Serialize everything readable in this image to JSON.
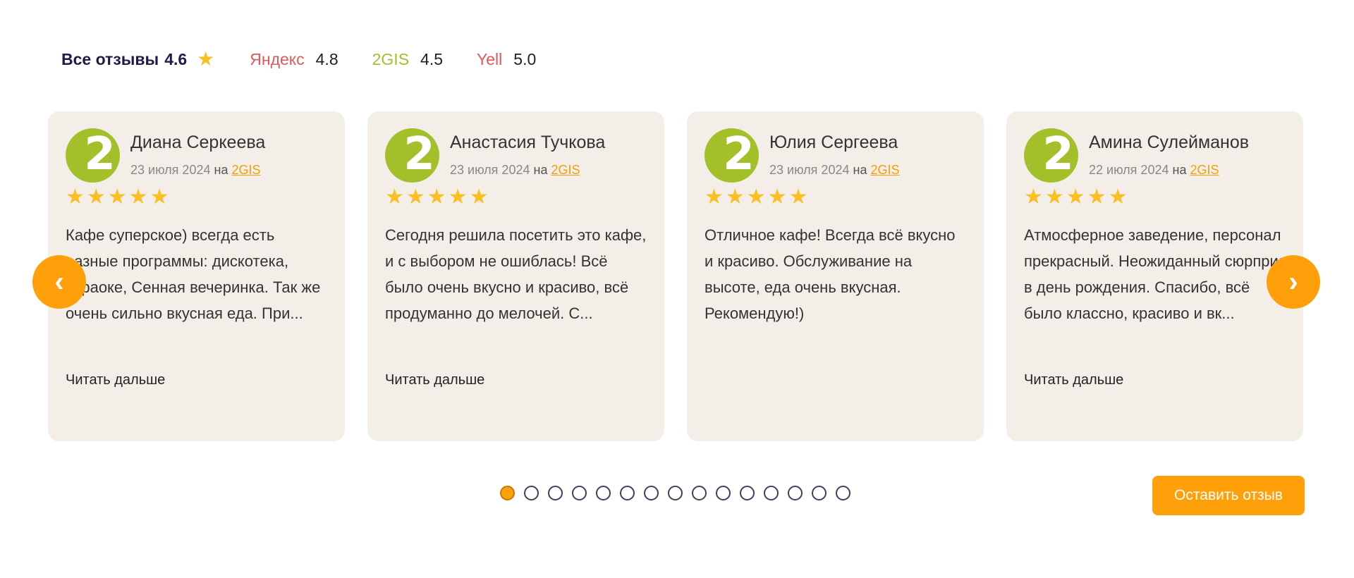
{
  "ratings": {
    "all_label": "Все отзывы",
    "all_value": "4.6",
    "sources": [
      {
        "name": "Яндекс",
        "value": "4.8"
      },
      {
        "name": "2GIS",
        "value": "4.5"
      },
      {
        "name": "Yell",
        "value": "5.0"
      }
    ]
  },
  "reviews": [
    {
      "avatar": "2",
      "author": "Диана Серкеева",
      "date": "23 июля 2024",
      "on": "на",
      "source": "2GIS",
      "stars": "★★★★★",
      "rating": 5,
      "text": "Кафе суперское) всегда есть разные программы: дискотека, караоке, Сенная вечеринка. Так же очень сильно вкусная еда. При...",
      "read_more": "Читать дальше"
    },
    {
      "avatar": "2",
      "author": "Анастасия Тучкова",
      "date": "23 июля 2024",
      "on": "на",
      "source": "2GIS",
      "stars": "★★★★★",
      "rating": 5,
      "text": "Сегодня решила посетить это кафе, и с выбором не ошиблась! Всё было очень вкусно и красиво, всё продуманно до мелочей. С...",
      "read_more": "Читать дальше"
    },
    {
      "avatar": "2",
      "author": "Юлия Сергеева",
      "date": "23 июля 2024",
      "on": "на",
      "source": "2GIS",
      "stars": "★★★★★",
      "rating": 5,
      "text": "Отличное кафе! Всегда всё вкусно и красиво. Обслуживание на высоте, еда очень вкусная. Рекомендую!)",
      "read_more": ""
    },
    {
      "avatar": "2",
      "author": "Амина Сулейманов",
      "date": "22 июля 2024",
      "on": "на",
      "source": "2GIS",
      "stars": "★★★★★",
      "rating": 5,
      "text": "Атмосферное заведение, персонал прекрасный. Неожиданный сюрприз в день рождения. Спасибо, всё было классно, красиво и вк...",
      "read_more": "Читать дальше"
    }
  ],
  "carousel": {
    "prev_icon": "‹",
    "next_icon": "›",
    "total_pages": 15,
    "active_page": 1
  },
  "leave_review_label": "Оставить отзыв",
  "colors": {
    "accent": "#ff9f0a",
    "card_bg": "#f3efe8",
    "star": "#fbbf24",
    "gis_green": "#a3c02a",
    "yandex_red": "#e15a5a"
  }
}
